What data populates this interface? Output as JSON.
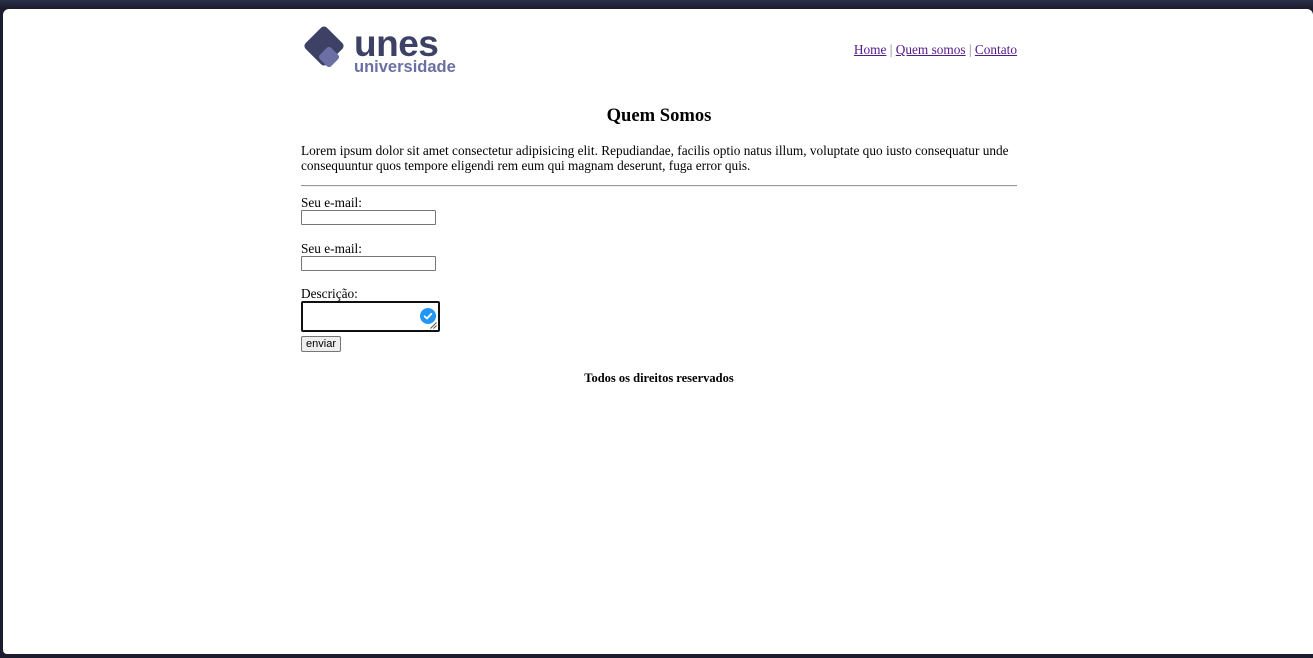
{
  "logo": {
    "brand": "unes",
    "sub": "universidade",
    "colors": {
      "primary": "#3d4166",
      "secondary": "#6b6fa3"
    }
  },
  "nav": {
    "items": [
      {
        "label": "Home"
      },
      {
        "label": "Quem somos"
      },
      {
        "label": "Contato"
      }
    ],
    "separator": "|"
  },
  "main": {
    "title": "Quem Somos",
    "paragraph": "Lorem ipsum dolor sit amet consectetur adipisicing elit. Repudiandae, facilis optio natus illum, voluptate quo iusto consequatur unde consequuntur quos tempore eligendi rem eum qui magnam deserunt, fuga error quis."
  },
  "form": {
    "email1_label": "Seu e-mail:",
    "email1_value": "",
    "email2_label": "Seu e-mail:",
    "email2_value": "",
    "description_label": "Descrição:",
    "description_value": "",
    "submit_label": "enviar"
  },
  "footer": {
    "text": "Todos os direitos reservados"
  },
  "colors": {
    "link": "#551a8b",
    "focus_check": "#2196f3"
  }
}
